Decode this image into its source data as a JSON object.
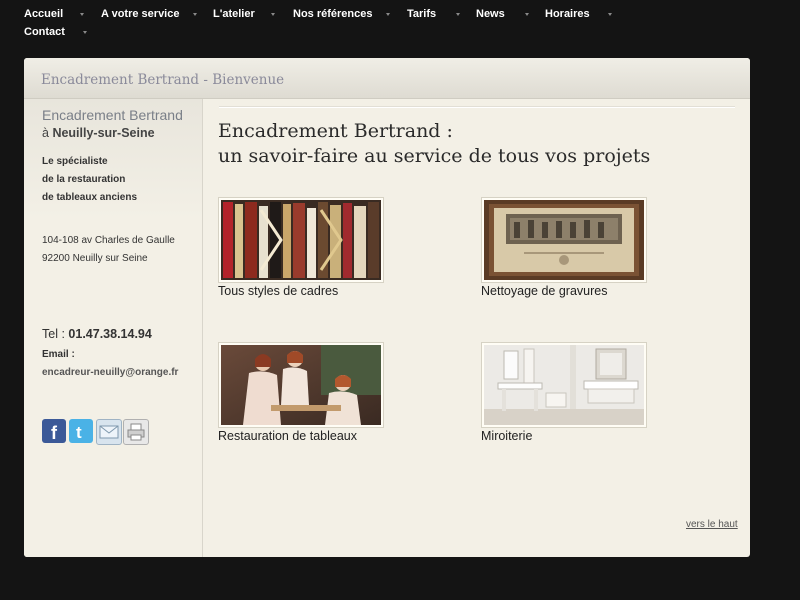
{
  "nav": {
    "items": [
      {
        "label": "Accueil"
      },
      {
        "label": "A votre service"
      },
      {
        "label": "L'atelier"
      },
      {
        "label": "Nos références"
      },
      {
        "label": "Tarifs"
      },
      {
        "label": "News"
      },
      {
        "label": "Horaires"
      },
      {
        "label": "Contact"
      }
    ]
  },
  "header": {
    "title": "Encadrement Bertrand - Bienvenue"
  },
  "sidebar": {
    "brand": "Encadrement Bertrand",
    "city_prefix": "à",
    "city": "Neuilly-sur-Seine",
    "tagline": [
      "Le spécialiste",
      "de la restauration",
      "de tableaux anciens"
    ],
    "address": [
      "104-108 av Charles de Gaulle",
      "92200 Neuilly sur Seine"
    ],
    "tel_label": "Tel :",
    "tel": "01.47.38.14.94",
    "email_label": "Email :",
    "email": "encadreur-neuilly@orange.fr",
    "share_icons": [
      "facebook-icon",
      "twitter-icon",
      "email-icon",
      "print-icon"
    ]
  },
  "main": {
    "title_line1": "Encadrement Bertrand :",
    "title_line2": "un savoir-faire au service de tous vos projets",
    "services": [
      {
        "caption": "Tous styles de cadres",
        "image": "frame-samples-image"
      },
      {
        "caption": "Nettoyage de gravures",
        "image": "framed-engraving-image"
      },
      {
        "caption": "Restauration de tableaux",
        "image": "painting-girls-image"
      },
      {
        "caption": "Miroiterie",
        "image": "mirror-bathroom-image"
      }
    ],
    "back_to_top": "vers le haut"
  },
  "colors": {
    "page_bg": "#141414",
    "box_bg": "#f3f0e6",
    "nav_text": "#ffffff",
    "header_title": "#8a8a9a"
  }
}
